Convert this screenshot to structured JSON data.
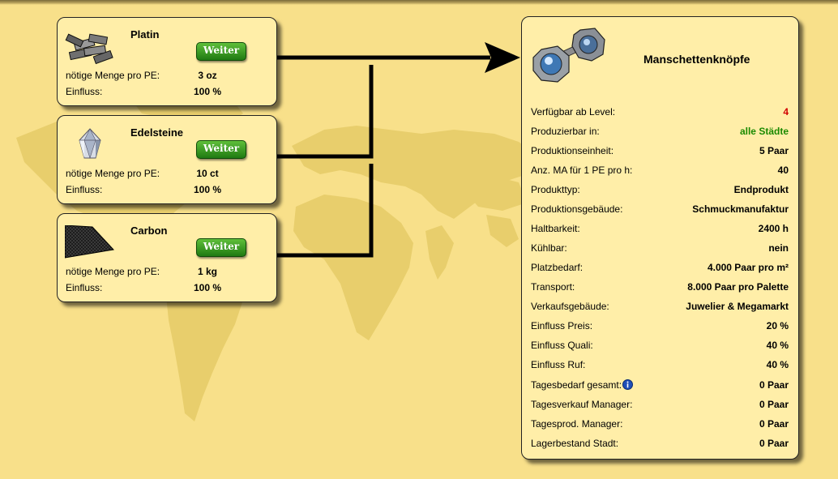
{
  "ingredients": [
    {
      "name": "Platin",
      "button": "Weiter",
      "menge_label": "nötige Menge pro PE:",
      "menge_value": "3 oz",
      "einfluss_label": "Einfluss:",
      "einfluss_value": "100 %"
    },
    {
      "name": "Edelsteine",
      "button": "Weiter",
      "menge_label": "nötige Menge pro PE:",
      "menge_value": "10 ct",
      "einfluss_label": "Einfluss:",
      "einfluss_value": "100 %"
    },
    {
      "name": "Carbon",
      "button": "Weiter",
      "menge_label": "nötige Menge pro PE:",
      "menge_value": "1 kg",
      "einfluss_label": "Einfluss:",
      "einfluss_value": "100 %"
    }
  ],
  "product": {
    "title": "Manschettenknöpfe",
    "rows": [
      {
        "label": "Verfügbar ab Level:",
        "value": "4",
        "color": "#d00000"
      },
      {
        "label": "Produzierbar in:",
        "value": "alle Städte",
        "color": "#1a8a00"
      },
      {
        "label": "Produktionseinheit:",
        "value": "5 Paar"
      },
      {
        "label": "Anz. MA für 1 PE pro h:",
        "value": "40"
      },
      {
        "label": "Produkttyp:",
        "value": "Endprodukt"
      },
      {
        "label": "Produktionsgebäude:",
        "value": "Schmuckmanufaktur"
      },
      {
        "label": "Haltbarkeit:",
        "value": "2400 h"
      },
      {
        "label": "Kühlbar:",
        "value": "nein"
      },
      {
        "label": "Platzbedarf:",
        "value": "4.000 Paar pro m²"
      },
      {
        "label": "Transport:",
        "value": "8.000 Paar pro Palette"
      },
      {
        "label": "Verkaufsgebäude:",
        "value": "Juwelier & Megamarkt"
      },
      {
        "label": "Einfluss Preis:",
        "value": "20 %"
      },
      {
        "label": "Einfluss Quali:",
        "value": "40 %"
      },
      {
        "label": "Einfluss Ruf:",
        "value": "40 %"
      },
      {
        "label": "Tagesbedarf gesamt:",
        "value": "0 Paar",
        "icon": "info-icon"
      },
      {
        "label": "Tagesverkauf Manager:",
        "value": "0 Paar"
      },
      {
        "label": "Tagesprod. Manager:",
        "value": "0 Paar"
      },
      {
        "label": "Lagerbestand Stadt:",
        "value": "0 Paar"
      }
    ]
  },
  "colors": {
    "background": "#f8e08a",
    "card": "#ffeea8",
    "map": "#e7cd6a",
    "button": "#2f9a1e"
  }
}
